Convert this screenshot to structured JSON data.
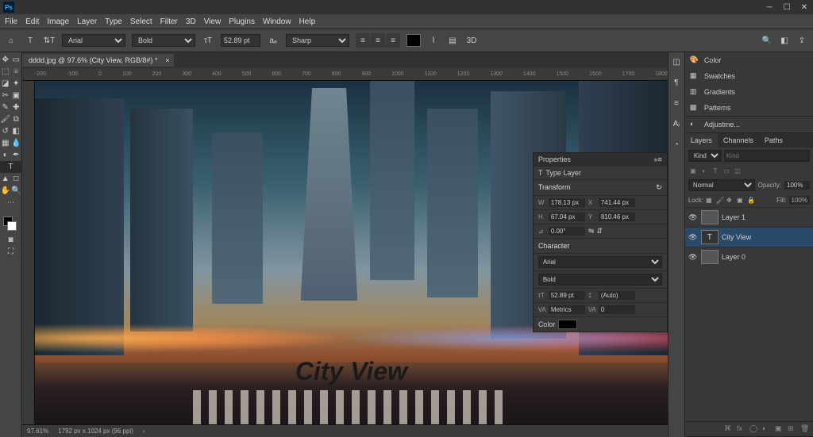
{
  "menu": [
    "File",
    "Edit",
    "Image",
    "Layer",
    "Type",
    "Select",
    "Filter",
    "3D",
    "View",
    "Plugins",
    "Window",
    "Help"
  ],
  "options": {
    "font_family": "Arial",
    "font_style": "Bold",
    "font_size": "52.89 pt",
    "aa": "Sharp",
    "threed": "3D"
  },
  "doc": {
    "tab_title": "dddd.jpg @ 97.6% (City View, RGB/8#) *",
    "zoom": "97.61%",
    "dims": "1792 px x 1024 px (96 ppi)",
    "canvas_text": "City View"
  },
  "ruler_marks": [
    "-200",
    "-100",
    "0",
    "100",
    "200",
    "300",
    "400",
    "500",
    "600",
    "700",
    "800",
    "900",
    "1000",
    "1100",
    "1200",
    "1300",
    "1400",
    "1500",
    "1600",
    "1700",
    "1800"
  ],
  "right_groups": {
    "color": "Color",
    "swatches": "Swatches",
    "gradients": "Gradients",
    "patterns": "Patterns",
    "adjustments": "Adjustme..."
  },
  "properties": {
    "title": "Properties",
    "type_layer": "Type Layer",
    "transform": "Transform",
    "w": "178.13 px",
    "x": "741.44 px",
    "h": "67.04 px",
    "y": "810.46 px",
    "angle": "0.00°",
    "character": "Character",
    "font_family": "Arial",
    "font_style": "Bold",
    "size": "52.89 pt",
    "leading": "(Auto)",
    "tracking": "Metrics",
    "kerning": "0",
    "color_label": "Color"
  },
  "layers_panel": {
    "tabs": [
      "Layers",
      "Channels",
      "Paths"
    ],
    "kind": "Kind",
    "blend": "Normal",
    "opacity_label": "Opacity:",
    "opacity": "100%",
    "lock_label": "Lock:",
    "fill_label": "Fill:",
    "fill": "100%",
    "layers": [
      {
        "name": "Layer 1",
        "type": "raster"
      },
      {
        "name": "City View",
        "type": "text"
      },
      {
        "name": "Layer 0",
        "type": "raster"
      }
    ]
  }
}
